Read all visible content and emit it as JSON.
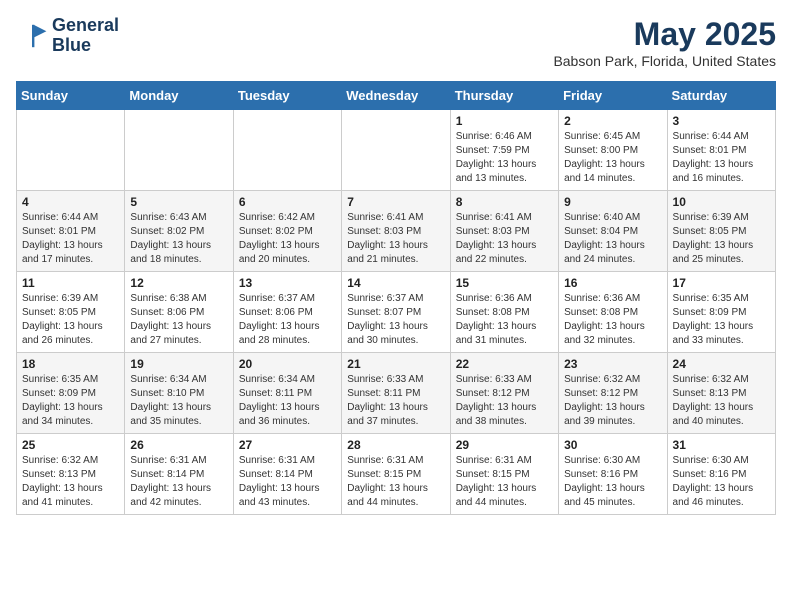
{
  "header": {
    "logo_line1": "General",
    "logo_line2": "Blue",
    "month": "May 2025",
    "location": "Babson Park, Florida, United States"
  },
  "weekdays": [
    "Sunday",
    "Monday",
    "Tuesday",
    "Wednesday",
    "Thursday",
    "Friday",
    "Saturday"
  ],
  "weeks": [
    [
      {
        "day": "",
        "info": ""
      },
      {
        "day": "",
        "info": ""
      },
      {
        "day": "",
        "info": ""
      },
      {
        "day": "",
        "info": ""
      },
      {
        "day": "1",
        "info": "Sunrise: 6:46 AM\nSunset: 7:59 PM\nDaylight: 13 hours\nand 13 minutes."
      },
      {
        "day": "2",
        "info": "Sunrise: 6:45 AM\nSunset: 8:00 PM\nDaylight: 13 hours\nand 14 minutes."
      },
      {
        "day": "3",
        "info": "Sunrise: 6:44 AM\nSunset: 8:01 PM\nDaylight: 13 hours\nand 16 minutes."
      }
    ],
    [
      {
        "day": "4",
        "info": "Sunrise: 6:44 AM\nSunset: 8:01 PM\nDaylight: 13 hours\nand 17 minutes."
      },
      {
        "day": "5",
        "info": "Sunrise: 6:43 AM\nSunset: 8:02 PM\nDaylight: 13 hours\nand 18 minutes."
      },
      {
        "day": "6",
        "info": "Sunrise: 6:42 AM\nSunset: 8:02 PM\nDaylight: 13 hours\nand 20 minutes."
      },
      {
        "day": "7",
        "info": "Sunrise: 6:41 AM\nSunset: 8:03 PM\nDaylight: 13 hours\nand 21 minutes."
      },
      {
        "day": "8",
        "info": "Sunrise: 6:41 AM\nSunset: 8:03 PM\nDaylight: 13 hours\nand 22 minutes."
      },
      {
        "day": "9",
        "info": "Sunrise: 6:40 AM\nSunset: 8:04 PM\nDaylight: 13 hours\nand 24 minutes."
      },
      {
        "day": "10",
        "info": "Sunrise: 6:39 AM\nSunset: 8:05 PM\nDaylight: 13 hours\nand 25 minutes."
      }
    ],
    [
      {
        "day": "11",
        "info": "Sunrise: 6:39 AM\nSunset: 8:05 PM\nDaylight: 13 hours\nand 26 minutes."
      },
      {
        "day": "12",
        "info": "Sunrise: 6:38 AM\nSunset: 8:06 PM\nDaylight: 13 hours\nand 27 minutes."
      },
      {
        "day": "13",
        "info": "Sunrise: 6:37 AM\nSunset: 8:06 PM\nDaylight: 13 hours\nand 28 minutes."
      },
      {
        "day": "14",
        "info": "Sunrise: 6:37 AM\nSunset: 8:07 PM\nDaylight: 13 hours\nand 30 minutes."
      },
      {
        "day": "15",
        "info": "Sunrise: 6:36 AM\nSunset: 8:08 PM\nDaylight: 13 hours\nand 31 minutes."
      },
      {
        "day": "16",
        "info": "Sunrise: 6:36 AM\nSunset: 8:08 PM\nDaylight: 13 hours\nand 32 minutes."
      },
      {
        "day": "17",
        "info": "Sunrise: 6:35 AM\nSunset: 8:09 PM\nDaylight: 13 hours\nand 33 minutes."
      }
    ],
    [
      {
        "day": "18",
        "info": "Sunrise: 6:35 AM\nSunset: 8:09 PM\nDaylight: 13 hours\nand 34 minutes."
      },
      {
        "day": "19",
        "info": "Sunrise: 6:34 AM\nSunset: 8:10 PM\nDaylight: 13 hours\nand 35 minutes."
      },
      {
        "day": "20",
        "info": "Sunrise: 6:34 AM\nSunset: 8:11 PM\nDaylight: 13 hours\nand 36 minutes."
      },
      {
        "day": "21",
        "info": "Sunrise: 6:33 AM\nSunset: 8:11 PM\nDaylight: 13 hours\nand 37 minutes."
      },
      {
        "day": "22",
        "info": "Sunrise: 6:33 AM\nSunset: 8:12 PM\nDaylight: 13 hours\nand 38 minutes."
      },
      {
        "day": "23",
        "info": "Sunrise: 6:32 AM\nSunset: 8:12 PM\nDaylight: 13 hours\nand 39 minutes."
      },
      {
        "day": "24",
        "info": "Sunrise: 6:32 AM\nSunset: 8:13 PM\nDaylight: 13 hours\nand 40 minutes."
      }
    ],
    [
      {
        "day": "25",
        "info": "Sunrise: 6:32 AM\nSunset: 8:13 PM\nDaylight: 13 hours\nand 41 minutes."
      },
      {
        "day": "26",
        "info": "Sunrise: 6:31 AM\nSunset: 8:14 PM\nDaylight: 13 hours\nand 42 minutes."
      },
      {
        "day": "27",
        "info": "Sunrise: 6:31 AM\nSunset: 8:14 PM\nDaylight: 13 hours\nand 43 minutes."
      },
      {
        "day": "28",
        "info": "Sunrise: 6:31 AM\nSunset: 8:15 PM\nDaylight: 13 hours\nand 44 minutes."
      },
      {
        "day": "29",
        "info": "Sunrise: 6:31 AM\nSunset: 8:15 PM\nDaylight: 13 hours\nand 44 minutes."
      },
      {
        "day": "30",
        "info": "Sunrise: 6:30 AM\nSunset: 8:16 PM\nDaylight: 13 hours\nand 45 minutes."
      },
      {
        "day": "31",
        "info": "Sunrise: 6:30 AM\nSunset: 8:16 PM\nDaylight: 13 hours\nand 46 minutes."
      }
    ]
  ]
}
